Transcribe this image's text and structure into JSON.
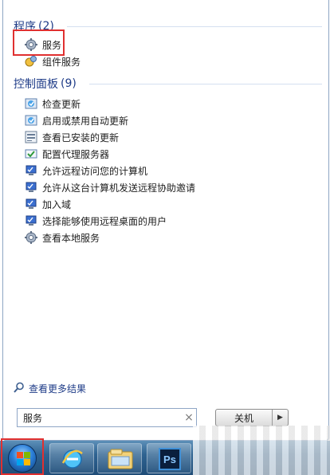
{
  "programs_group": {
    "title": "程序",
    "count": "(2)",
    "items": [
      {
        "label": "服务",
        "icon": "services-gear-icon"
      },
      {
        "label": "组件服务",
        "icon": "component-services-icon"
      }
    ]
  },
  "control_panel_group": {
    "title": "控制面板",
    "count": "(9)",
    "items": [
      {
        "label": "检查更新",
        "icon": "windows-update-icon"
      },
      {
        "label": "启用或禁用自动更新",
        "icon": "windows-update-icon"
      },
      {
        "label": "查看已安装的更新",
        "icon": "installed-updates-icon"
      },
      {
        "label": "配置代理服务器",
        "icon": "proxy-settings-icon"
      },
      {
        "label": "允许远程访问您的计算机",
        "icon": "remote-access-icon"
      },
      {
        "label": "允许从这台计算机发送远程协助邀请",
        "icon": "remote-assist-icon"
      },
      {
        "label": "加入域",
        "icon": "system-icon"
      },
      {
        "label": "选择能够使用远程桌面的用户",
        "icon": "remote-desktop-users-icon"
      },
      {
        "label": "查看本地服务",
        "icon": "local-services-icon"
      }
    ]
  },
  "more_results": {
    "label": "查看更多结果",
    "icon": "search-icon"
  },
  "search": {
    "value": "服务",
    "clear_icon": "close-icon"
  },
  "shutdown": {
    "label": "关机",
    "arrow_icon": "triangle-right-icon"
  },
  "taskbar": {
    "buttons": [
      {
        "name": "start",
        "icon": "windows-start-orb-icon"
      },
      {
        "name": "ie",
        "icon": "internet-explorer-icon"
      },
      {
        "name": "explorer",
        "icon": "file-explorer-icon"
      },
      {
        "name": "photoshop",
        "icon": "photoshop-icon",
        "label": "Ps"
      }
    ]
  },
  "colors": {
    "group_title": "#1f3c88",
    "highlight": "#e03030",
    "taskbar": "#2f6391"
  }
}
